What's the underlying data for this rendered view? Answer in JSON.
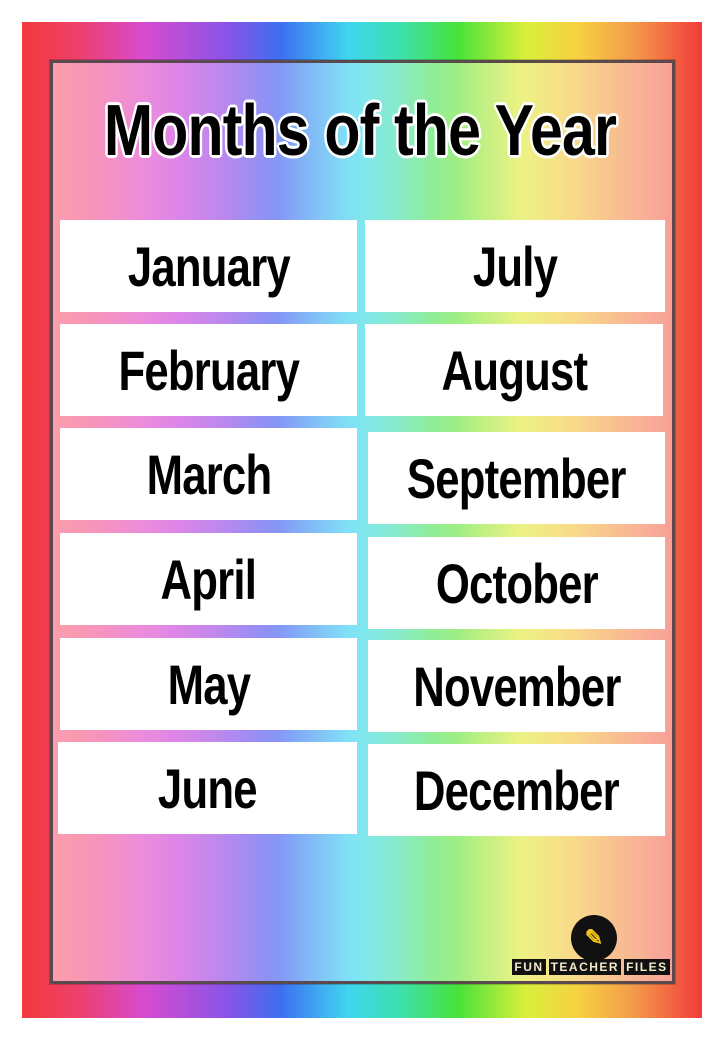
{
  "title": "Months of the Year",
  "months_left": [
    "January",
    "February",
    "March",
    "April",
    "May",
    "June"
  ],
  "months_right": [
    "July",
    "August",
    "September",
    "October",
    "November",
    "December"
  ],
  "logo": {
    "words": [
      "FUN",
      "TEACHER",
      "FILES"
    ],
    "icon": "pencil-icon"
  },
  "colors": {
    "border_red": "#f23a3a",
    "card": "#ffffff",
    "text": "#000000"
  }
}
